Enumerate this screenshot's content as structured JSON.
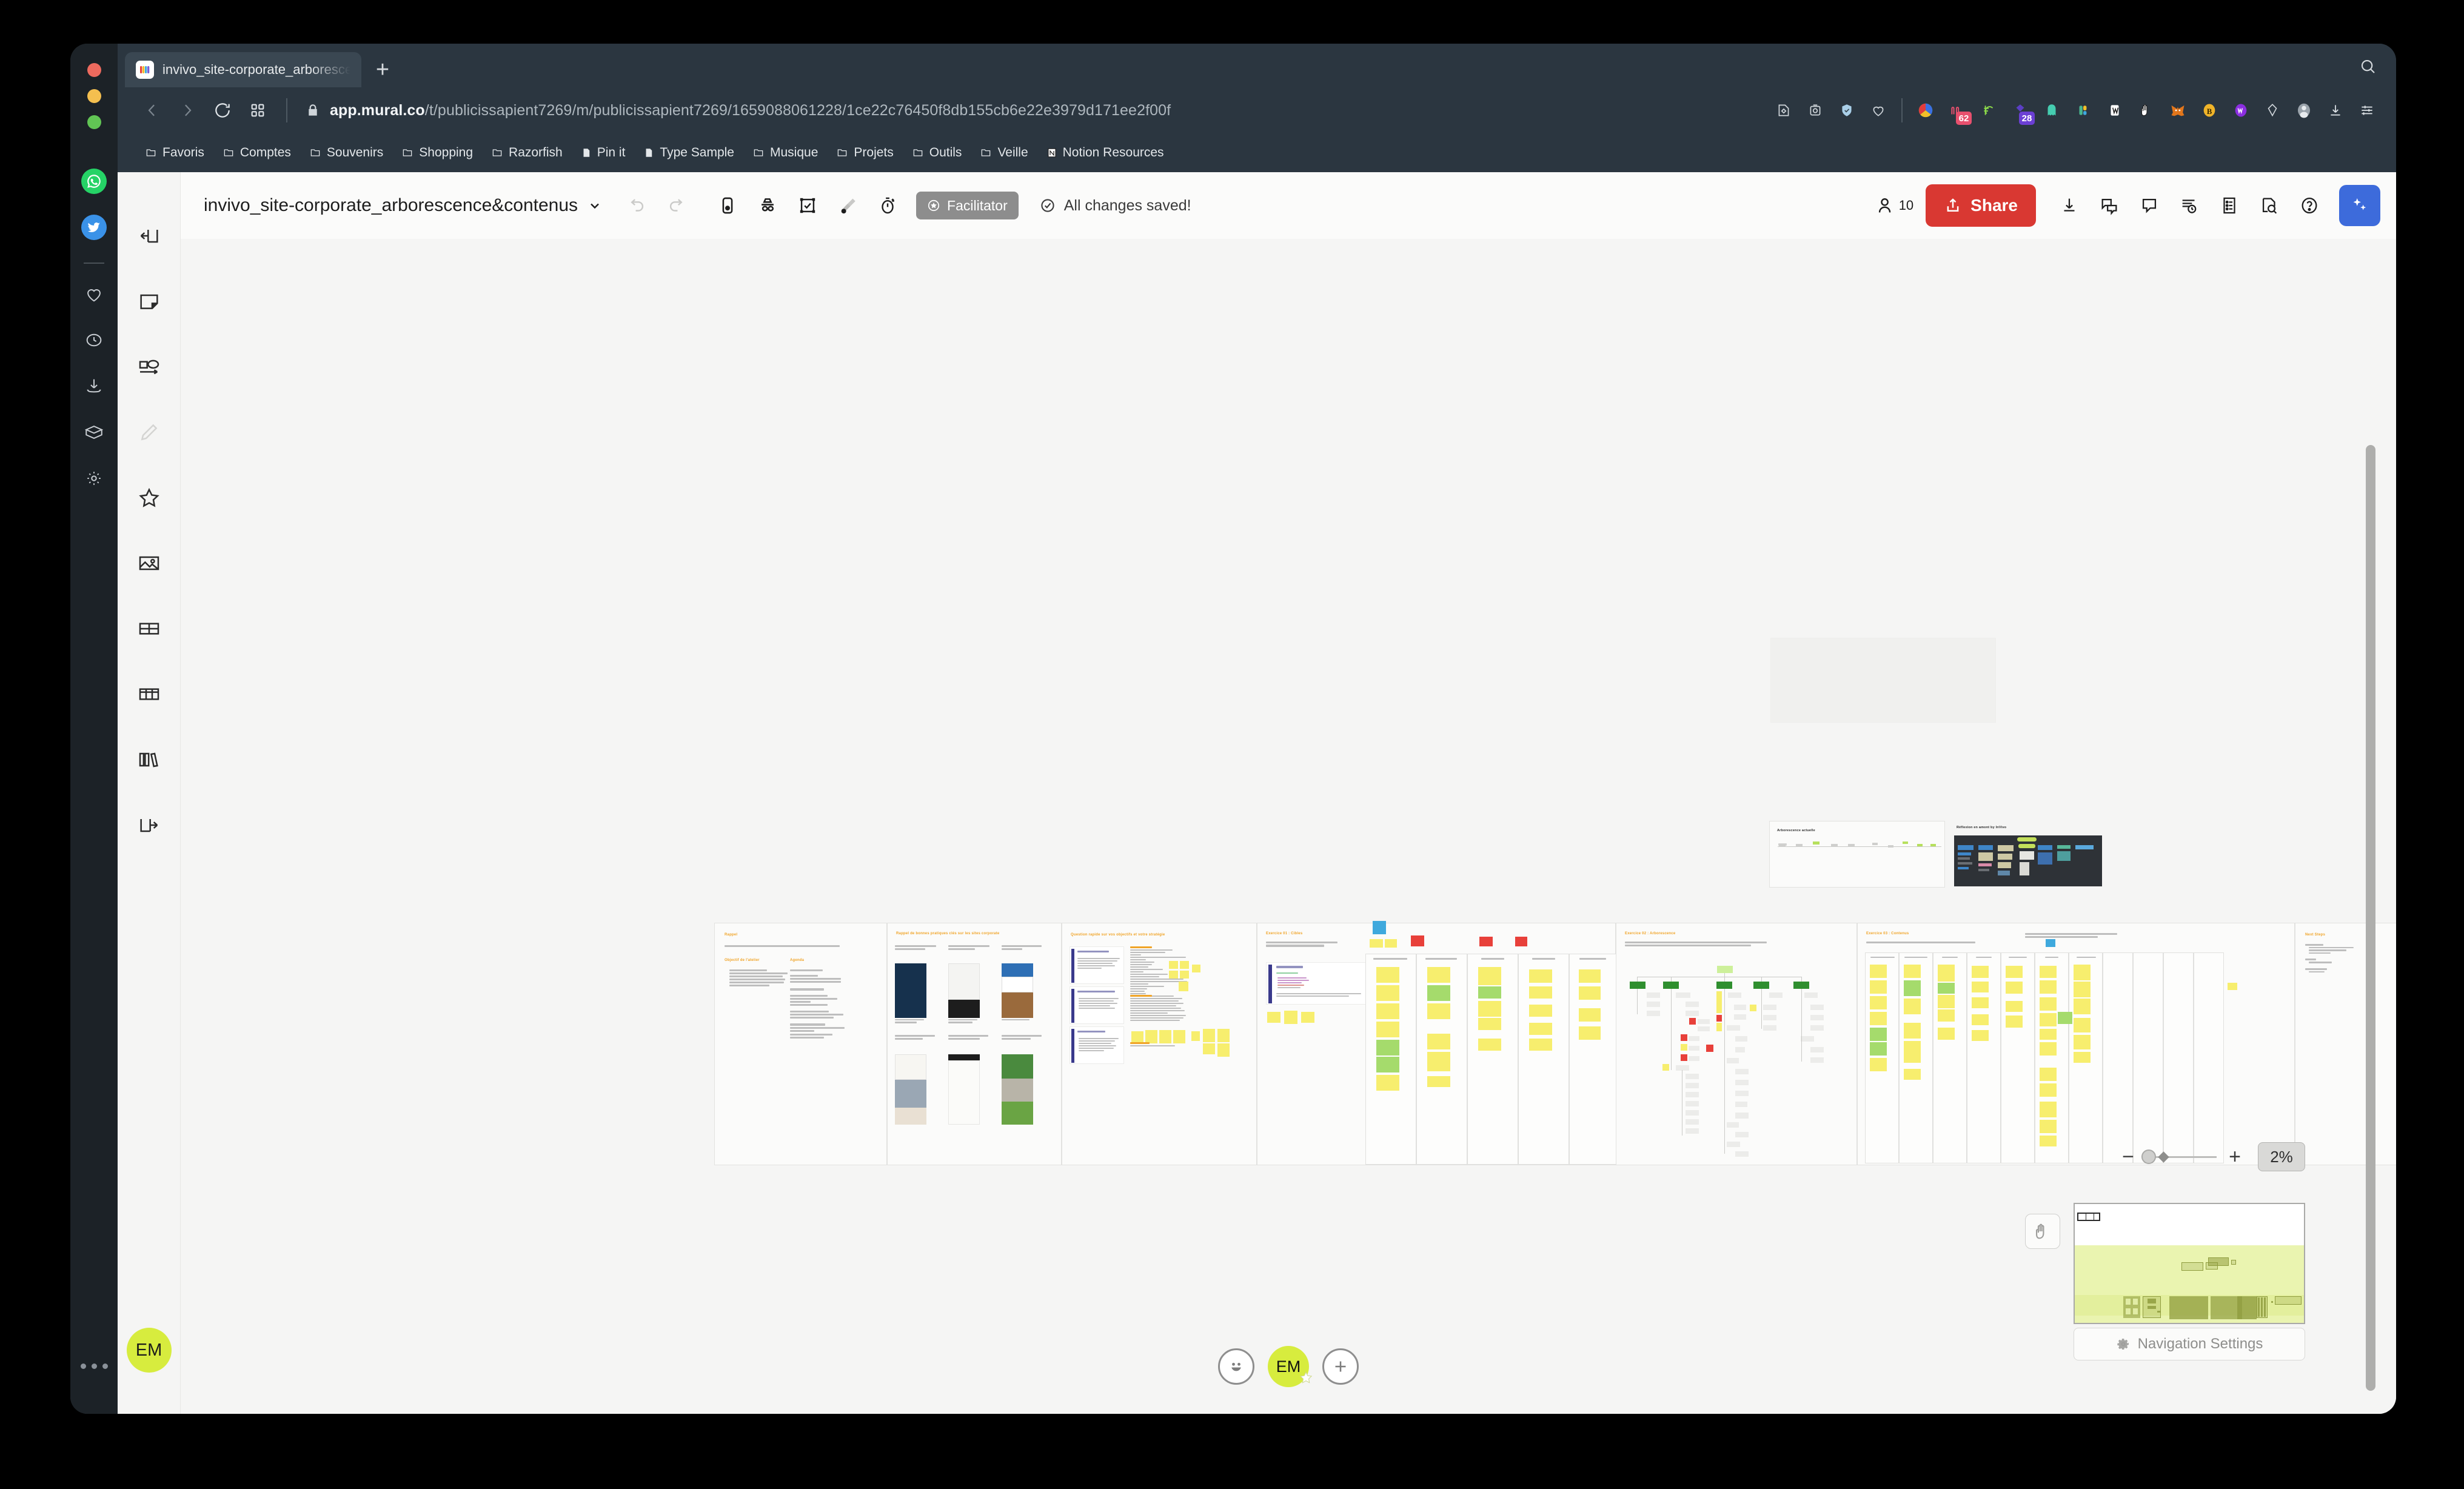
{
  "browser": {
    "tab": {
      "title": "invivo_site-corporate_arboresce",
      "favicon": "mural-icon"
    },
    "newtab_label": "+",
    "url": {
      "domain_bold": "app.mural.co",
      "path": "/t/publicissapient7269/m/publicissapient7269/1659088061228/1ce22c76450f8db155cb6e22e3979d171ee2f00f"
    },
    "nav": {
      "back": "back-icon",
      "forward": "forward-icon",
      "reload": "reload-icon",
      "apps": "apps-grid-icon",
      "lock": "lock-icon"
    },
    "bookmarks": [
      {
        "label": "Favoris",
        "icon": "folder-icon"
      },
      {
        "label": "Comptes",
        "icon": "folder-icon"
      },
      {
        "label": "Souvenirs",
        "icon": "folder-icon"
      },
      {
        "label": "Shopping",
        "icon": "folder-icon"
      },
      {
        "label": "Razorfish",
        "icon": "folder-icon"
      },
      {
        "label": "Pin it",
        "icon": "page-icon"
      },
      {
        "label": "Type Sample",
        "icon": "page-icon"
      },
      {
        "label": "Musique",
        "icon": "folder-icon"
      },
      {
        "label": "Projets",
        "icon": "folder-icon"
      },
      {
        "label": "Outils",
        "icon": "folder-icon"
      },
      {
        "label": "Veille",
        "icon": "folder-icon"
      },
      {
        "label": "Notion Resources",
        "icon": "notion-icon"
      }
    ],
    "extensions": [
      {
        "name": "edit-icon",
        "badge": ""
      },
      {
        "name": "screenshot-icon",
        "badge": ""
      },
      {
        "name": "shield-check-icon",
        "badge": ""
      },
      {
        "name": "heart-icon",
        "badge": ""
      },
      {
        "name": "color-wheel-icon",
        "badge": ""
      },
      {
        "name": "momentum-icon",
        "badge": "62",
        "badge_color": "#e8506e"
      },
      {
        "name": "grammarly-icon",
        "badge": ""
      },
      {
        "name": "evernote-icon",
        "badge": "28",
        "badge_color": "#6b3fd4"
      },
      {
        "name": "ghostery-icon",
        "badge": ""
      },
      {
        "name": "pocket-icon",
        "badge": ""
      },
      {
        "name": "wallet-icon",
        "badge": ""
      },
      {
        "name": "hand-icon",
        "badge": ""
      },
      {
        "name": "metamask-icon",
        "badge": ""
      },
      {
        "name": "brave-rewards-icon",
        "badge": ""
      },
      {
        "name": "wallet-purple-icon",
        "badge": ""
      },
      {
        "name": "diamond-icon",
        "badge": ""
      },
      {
        "name": "profile-icon",
        "badge": ""
      },
      {
        "name": "download-icon",
        "badge": ""
      },
      {
        "name": "menu-icon",
        "badge": ""
      }
    ],
    "rail": [
      {
        "name": "whatsapp-icon"
      },
      {
        "name": "twitter-icon"
      },
      {
        "name": "heart-icon"
      },
      {
        "name": "history-clock-icon"
      },
      {
        "name": "downloads-icon"
      },
      {
        "name": "box-icon"
      },
      {
        "name": "gear-icon"
      }
    ],
    "rail_more": "more-dots-icon"
  },
  "mural": {
    "board_title": "invivo_site-corporate_arborescence&contenus",
    "title_chevron": "chevron-down-icon",
    "undo": "undo-icon",
    "redo": "redo-icon",
    "header_tools": [
      {
        "name": "select-tool-icon"
      },
      {
        "name": "outline-icon"
      },
      {
        "name": "checkbox-frame-icon"
      },
      {
        "name": "eraser-icon"
      },
      {
        "name": "timer-icon"
      }
    ],
    "facilitator_badge": {
      "label": "Facilitator",
      "icon": "star-icon"
    },
    "save_status": {
      "label": "All changes saved!",
      "icon": "check-circle-icon"
    },
    "people_count": "10",
    "people_icon": "person-icon",
    "share_button": {
      "label": "Share",
      "icon": "share-upload-icon"
    },
    "right_tools": [
      {
        "name": "export-download-icon"
      },
      {
        "name": "chat-icon"
      },
      {
        "name": "comment-icon"
      },
      {
        "name": "activity-history-icon"
      },
      {
        "name": "outline-list-icon"
      },
      {
        "name": "find-icon"
      },
      {
        "name": "help-icon"
      }
    ],
    "ai_button": {
      "name": "ai-sparkle-icon",
      "color": "#3d6bdb"
    },
    "tool_rail": [
      {
        "name": "back-arrow-box-icon"
      },
      {
        "name": "sticky-note-icon"
      },
      {
        "name": "shapes-connector-icon"
      },
      {
        "name": "pen-icon",
        "disabled": true
      },
      {
        "name": "star-icon"
      },
      {
        "name": "image-icon"
      },
      {
        "name": "grid-icon"
      },
      {
        "name": "table-icon"
      },
      {
        "name": "library-icon"
      },
      {
        "name": "next-arrow-box-icon"
      }
    ],
    "tool_avatar": "EM",
    "zoom": {
      "value": "2%",
      "minus": "−",
      "plus": "+"
    },
    "hand_tool": "hand-pan-icon",
    "navigation_settings": {
      "label": "Navigation Settings",
      "icon": "gear-icon"
    },
    "userbar": {
      "reaction": "emoji-smiley-icon",
      "me": "EM",
      "me_badge": "facilitator-star-icon",
      "add": "+"
    },
    "canvas_panels": [
      {
        "id": "p1",
        "title": "Rappel",
        "subtitle": ""
      },
      {
        "id": "p2",
        "title": "Rappel de bonnes pratiques clés sur les sites corporate",
        "subtitle": ""
      },
      {
        "id": "p3",
        "title": "Question rapide sur vos objectifs et votre stratégie",
        "subtitle": ""
      },
      {
        "id": "p4",
        "title": "Exercice 01 : Cibles",
        "subtitle": "Qui vient sur votre site ? Pourquoi ?\nQuelle est la cible prioritaire ?"
      },
      {
        "id": "p5",
        "title": "Exercice 02 : Arborescence",
        "subtitle": "Regard et discussion autour du résultat de la proposition de l'arborescence.\nNous parlons ici de sections, pas encore précisément de pages"
      },
      {
        "id": "p6",
        "title": "Exercice 03 : Contenus",
        "subtitle": "Quels sont les contenus, idées, concepts, associés ?"
      },
      {
        "id": "p7",
        "title": "Next Steps",
        "subtitle": ""
      }
    ],
    "canvas_small_panels": [
      {
        "id": "sp1",
        "title": "Arborescence actuelle"
      },
      {
        "id": "sp2",
        "title": "Réflexion en amont by InVivo"
      }
    ]
  }
}
